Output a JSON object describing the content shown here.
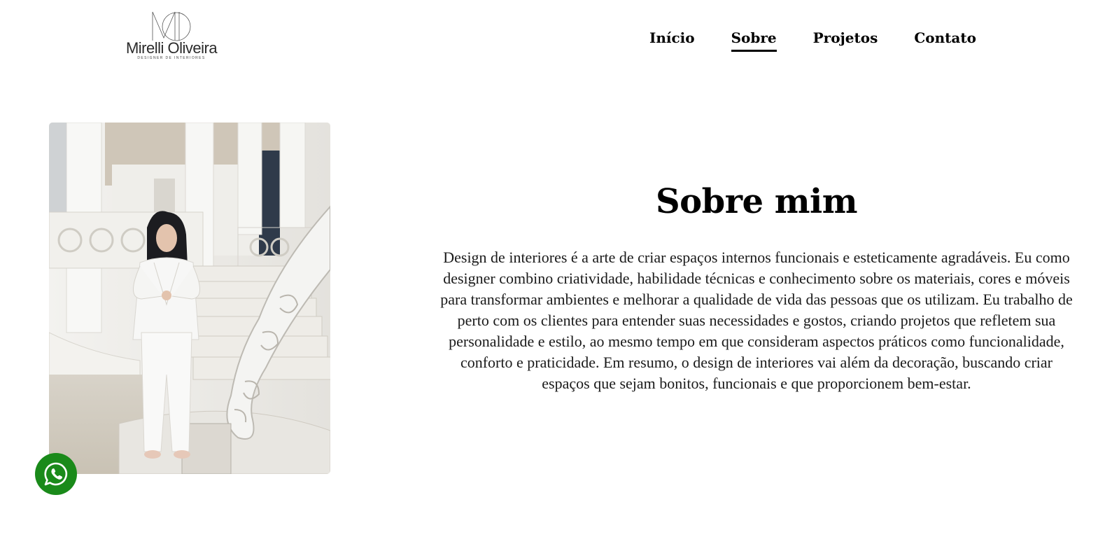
{
  "brand": {
    "name": "Mirelli Oliveira",
    "tagline": "DESIGNER DE INTERIORES",
    "monogram": "MO"
  },
  "nav": {
    "items": [
      {
        "label": "Início",
        "active": false
      },
      {
        "label": "Sobre",
        "active": true
      },
      {
        "label": "Projetos",
        "active": false
      },
      {
        "label": "Contato",
        "active": false
      }
    ]
  },
  "about": {
    "title": "Sobre mim",
    "body": "Design de interiores é a arte de criar espaços internos funcionais e esteticamente agradáveis. Eu como designer combino criatividade, habilidade técnicas e conhecimento sobre os materiais, cores e móveis para transformar ambientes e melhorar a qualidade de vida das pessoas que os utilizam. Eu trabalho de perto com os clientes para entender suas necessidades e gostos, criando projetos que refletem sua personalidade e estilo, ao mesmo tempo em que consideram aspectos práticos como funcionalidade, conforto e praticidade. Em resumo, o design de interiores vai além da decoração, buscando criar espaços que sejam bonitos, funcionais e que proporcionem bem-estar."
  },
  "colors": {
    "background": "#ffffff",
    "text": "#000000",
    "whatsapp": "#1a8a1a"
  },
  "icons": {
    "floating_button": "whatsapp-icon"
  }
}
